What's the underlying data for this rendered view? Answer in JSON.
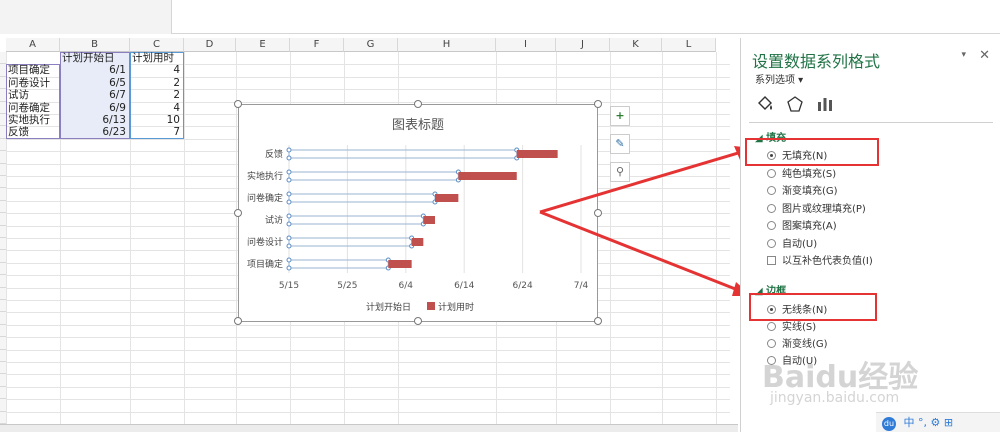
{
  "sheet": {
    "columns": [
      "A",
      "B",
      "C",
      "D",
      "E",
      "F",
      "G",
      "H",
      "I",
      "J",
      "K",
      "L"
    ],
    "header_row": [
      "",
      "计划开始日",
      "计划用时"
    ],
    "rows": [
      {
        "task": "项目确定",
        "start": "6/1",
        "duration": "4"
      },
      {
        "task": "问卷设计",
        "start": "6/5",
        "duration": "2"
      },
      {
        "task": "试访",
        "start": "6/7",
        "duration": "2"
      },
      {
        "task": "问卷确定",
        "start": "6/9",
        "duration": "4"
      },
      {
        "task": "实地执行",
        "start": "6/13",
        "duration": "10"
      },
      {
        "task": "反馈",
        "start": "6/23",
        "duration": "7"
      }
    ]
  },
  "chart": {
    "title": "图表标题",
    "categories": [
      "反馈",
      "实地执行",
      "问卷确定",
      "试访",
      "问卷设计",
      "项目确定"
    ],
    "x_ticks": [
      "5/15",
      "5/25",
      "6/4",
      "6/14",
      "6/24",
      "7/4"
    ],
    "legend": [
      "计划开始日",
      "计划用时"
    ],
    "bar_color": "#c0504d",
    "side_buttons": [
      "+",
      "✎",
      "⚲"
    ]
  },
  "chart_data": {
    "type": "bar",
    "orientation": "horizontal-stacked",
    "title": "图表标题",
    "categories": [
      "项目确定",
      "问卷设计",
      "试访",
      "问卷确定",
      "实地执行",
      "反馈"
    ],
    "series": [
      {
        "name": "计划开始日",
        "values": [
          "6/1",
          "6/5",
          "6/7",
          "6/9",
          "6/13",
          "6/23"
        ],
        "fill": "none"
      },
      {
        "name": "计划用时",
        "values": [
          4,
          2,
          2,
          4,
          10,
          7
        ],
        "color": "#c0504d"
      }
    ],
    "xlim": [
      "5/15",
      "7/4"
    ],
    "x_ticks": [
      "5/15",
      "5/25",
      "6/4",
      "6/14",
      "6/24",
      "7/4"
    ],
    "legend_position": "bottom",
    "grid": true
  },
  "panel": {
    "title": "设置数据系列格式",
    "subtitle": "系列选项",
    "section_fill": "填充",
    "fill_options": [
      "无填充(N)",
      "纯色填充(S)",
      "渐变填充(G)",
      "图片或纹理填充(P)",
      "图案填充(A)",
      "自动(U)"
    ],
    "invert_label": "以互补色代表负值(I)",
    "section_border": "边框",
    "border_options": [
      "无线条(N)",
      "实线(S)",
      "渐变线(G)",
      "自动(U)"
    ],
    "accent": "#217346",
    "highlight_color": "#e53333"
  },
  "watermark": {
    "brand": "Baidu经验",
    "url": "jingyan.baidu.com"
  },
  "taskbar": {
    "ime": "中"
  }
}
